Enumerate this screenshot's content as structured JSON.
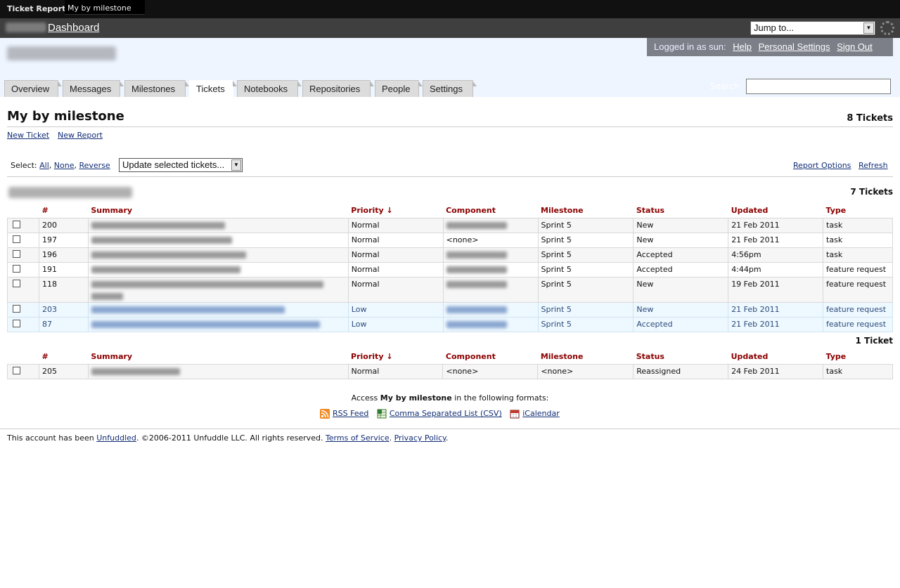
{
  "topbar": {
    "crumb_section": "Ticket Reports",
    "crumb_current": "My by milestone"
  },
  "dashbar": {
    "dashboard_link": "Dashboard",
    "jump_placeholder": "Jump to..."
  },
  "userbox": {
    "logged_in_text": "Logged in as sun:",
    "help": "Help",
    "personal_settings": "Personal Settings",
    "sign_out": "Sign Out"
  },
  "tabs": [
    "Overview",
    "Messages",
    "Milestones",
    "Tickets",
    "Notebooks",
    "Repositories",
    "People",
    "Settings"
  ],
  "active_tab": "Tickets",
  "search": {
    "label": "Search"
  },
  "page": {
    "title": "My by milestone",
    "ticket_count": "8 Tickets",
    "new_ticket": "New Ticket",
    "new_report": "New Report"
  },
  "selection": {
    "label": "Select:",
    "all": "All",
    "none": "None",
    "reverse": "Reverse",
    "update_select": "Update selected tickets...",
    "report_options": "Report Options",
    "refresh": "Refresh"
  },
  "columns": [
    "#",
    "Summary",
    "Priority ↓",
    "Component",
    "Milestone",
    "Status",
    "Updated",
    "Type"
  ],
  "groups": [
    {
      "count": "7 Tickets",
      "rows": [
        {
          "num": "200",
          "priority": "Normal",
          "component": "",
          "milestone": "Sprint 5",
          "status": "New",
          "updated": "21 Feb 2011",
          "type": "task",
          "style": "odd",
          "summary_width": 190,
          "component_width": 86
        },
        {
          "num": "197",
          "priority": "Normal",
          "component": "<none>",
          "milestone": "Sprint 5",
          "status": "New",
          "updated": "21 Feb 2011",
          "type": "task",
          "style": "even",
          "summary_width": 200,
          "component_width": 0
        },
        {
          "num": "196",
          "priority": "Normal",
          "component": "",
          "milestone": "Sprint 5",
          "status": "Accepted",
          "updated": "4:56pm",
          "type": "task",
          "style": "odd",
          "summary_width": 220,
          "component_width": 86
        },
        {
          "num": "191",
          "priority": "Normal",
          "component": "",
          "milestone": "Sprint 5",
          "status": "Accepted",
          "updated": "4:44pm",
          "type": "feature request",
          "style": "even",
          "summary_width": 212,
          "component_width": 86
        },
        {
          "num": "118",
          "priority": "Normal",
          "component": "",
          "milestone": "Sprint 5",
          "status": "New",
          "updated": "19 Feb 2011",
          "type": "feature request",
          "style": "odd tall",
          "summary_width": 330,
          "component_width": 86
        },
        {
          "num": "203",
          "priority": "Low",
          "component": "",
          "milestone": "Sprint 5",
          "status": "New",
          "updated": "21 Feb 2011",
          "type": "feature request",
          "style": "low",
          "summary_width": 275,
          "component_width": 86
        },
        {
          "num": "87",
          "priority": "Low",
          "component": "",
          "milestone": "Sprint 5",
          "status": "Accepted",
          "updated": "21 Feb 2011",
          "type": "feature request",
          "style": "low",
          "summary_width": 325,
          "component_width": 86
        }
      ]
    },
    {
      "count": "1 Ticket",
      "rows": [
        {
          "num": "205",
          "priority": "Normal",
          "component": "<none>",
          "milestone": "<none>",
          "status": "Reassigned",
          "updated": "24 Feb 2011",
          "type": "task",
          "style": "odd",
          "summary_width": 126,
          "component_width": 0
        }
      ]
    }
  ],
  "formats": {
    "prefix": "Access ",
    "name": "My by milestone",
    "suffix": " in the following formats:",
    "rss": "RSS Feed",
    "csv": "Comma Separated List (CSV)",
    "ical": "iCalendar",
    "icons": [
      "rss-icon",
      "csv-icon",
      "calendar-icon"
    ]
  },
  "footer": {
    "prefix": "This account has been ",
    "unfuddled": "Unfuddled",
    "copyright": ". ©2006-2011 Unfuddle LLC. All rights reserved. ",
    "terms": "Terms of Service",
    "privacy": "Privacy Policy"
  },
  "colors": {
    "header_bg": "#eef5ff",
    "column_header": "#8b0000",
    "link": "#102c74",
    "low_row_bg": "#eef8ff"
  }
}
